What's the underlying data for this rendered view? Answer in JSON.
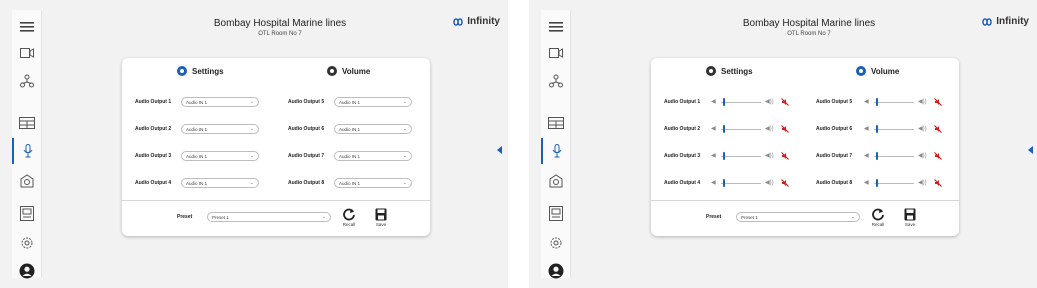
{
  "header": {
    "title": "Bombay Hospital Marine lines",
    "subtitle": "OTL Room No 7",
    "brand": "Infinity"
  },
  "sidebar": {
    "items": [
      {
        "icon": "menu-icon"
      },
      {
        "icon": "camera-icon"
      },
      {
        "icon": "network-icon"
      },
      {
        "icon": "display-grid-icon"
      },
      {
        "icon": "microphone-icon",
        "active": true
      },
      {
        "icon": "lighting-icon"
      },
      {
        "icon": "document-icon"
      },
      {
        "icon": "settings-gear-icon"
      },
      {
        "icon": "user-avatar-icon"
      }
    ]
  },
  "settings_screen": {
    "tabs": [
      {
        "label": "Settings",
        "selected": true
      },
      {
        "label": "Volume",
        "selected": false
      }
    ],
    "outputs_left": [
      {
        "label": "Audio Output 1",
        "value": "Audio IN 1"
      },
      {
        "label": "Audio Output 2",
        "value": "Audio IN 1"
      },
      {
        "label": "Audio Output 3",
        "value": "Audio IN 1"
      },
      {
        "label": "Audio Output 4",
        "value": "Audio IN 1"
      }
    ],
    "outputs_right": [
      {
        "label": "Audio Output 5",
        "value": "Audio IN 1"
      },
      {
        "label": "Audio Output 6",
        "value": "Audio IN 1"
      },
      {
        "label": "Audio Output 7",
        "value": "Audio IN 1"
      },
      {
        "label": "Audio Output 8",
        "value": "Audio IN 1"
      }
    ],
    "preset": {
      "label": "Preset",
      "value": "Preset 1"
    },
    "recall_label": "Recall",
    "save_label": "Save"
  },
  "volume_screen": {
    "tabs": [
      {
        "label": "Settings",
        "selected": false
      },
      {
        "label": "Volume",
        "selected": true
      }
    ],
    "outputs_left": [
      {
        "label": "Audio Output 1",
        "level": 0.05
      },
      {
        "label": "Audio Output 2",
        "level": 0.05
      },
      {
        "label": "Audio Output 3",
        "level": 0.05
      },
      {
        "label": "Audio Output 4",
        "level": 0.05
      }
    ],
    "outputs_right": [
      {
        "label": "Audio Output 5",
        "level": 0.05
      },
      {
        "label": "Audio Output 6",
        "level": 0.05
      },
      {
        "label": "Audio Output 7",
        "level": 0.05
      },
      {
        "label": "Audio Output 8",
        "level": 0.05
      }
    ],
    "preset": {
      "label": "Preset",
      "value": "Preset 1"
    },
    "recall_label": "Recall",
    "save_label": "Save"
  },
  "colors": {
    "accent": "#1c5fb8",
    "mute": "#d21f1f"
  }
}
